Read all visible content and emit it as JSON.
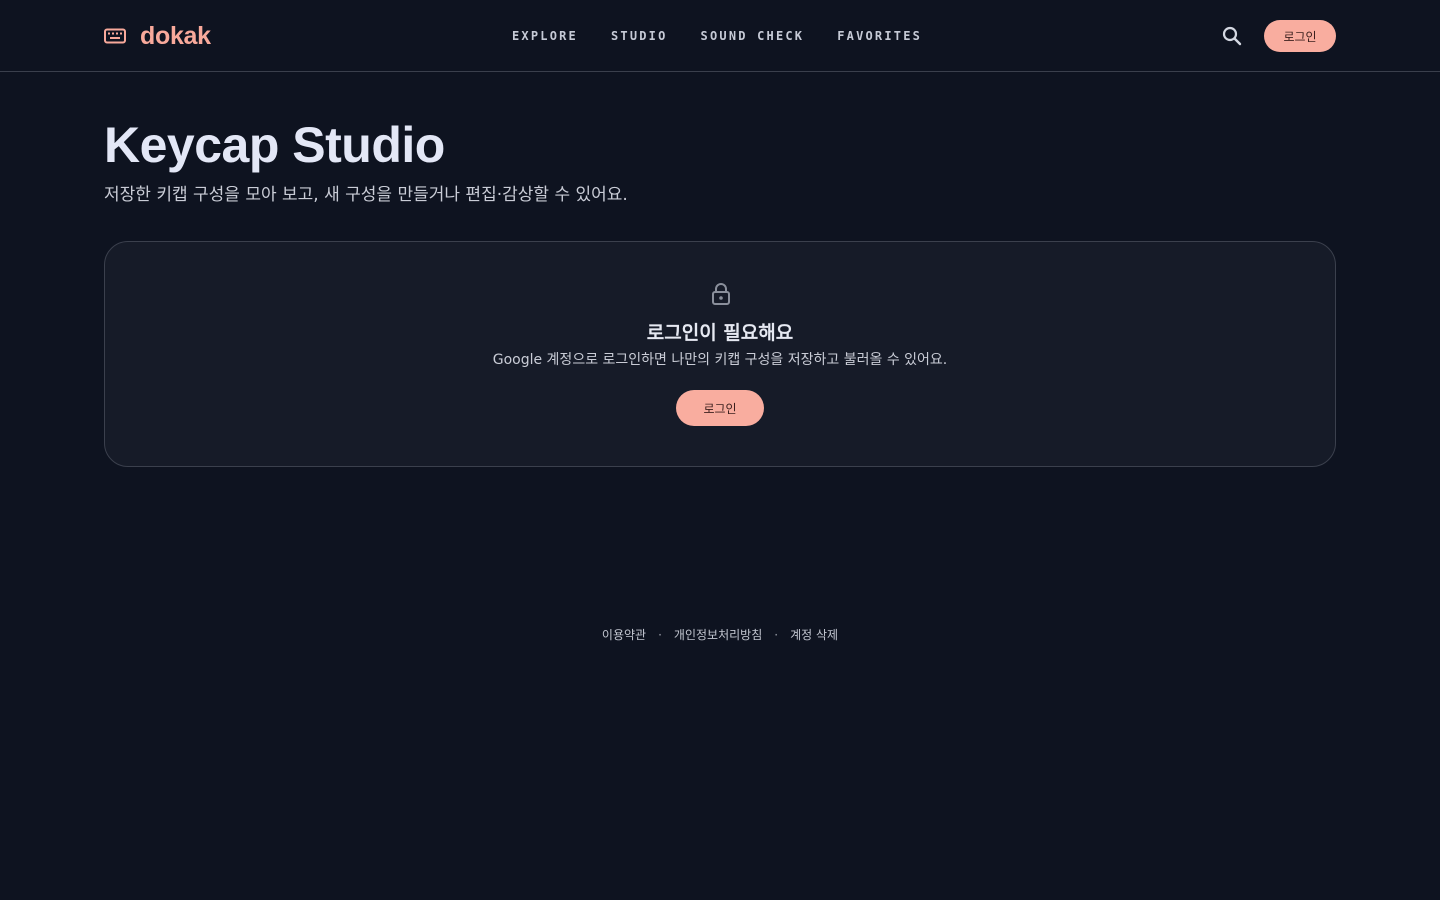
{
  "header": {
    "logo_text": "dokak",
    "logo_icon": "keyboard-icon",
    "nav": [
      {
        "label": "EXPLORE"
      },
      {
        "label": "STUDIO"
      },
      {
        "label": "SOUND CHECK"
      },
      {
        "label": "FAVORITES"
      }
    ],
    "search_icon": "search-icon",
    "login_label": "로그인"
  },
  "main": {
    "title": "Keycap Studio",
    "subtitle": "저장한 키캡 구성을 모아 보고, 새 구성을 만들거나 편집·감상할 수 있어요.",
    "card": {
      "icon": "lock-icon",
      "title": "로그인이 필요해요",
      "description": "Google 계정으로 로그인하면 나만의 키캡 구성을 저장하고 불러올 수 있어요.",
      "button_label": "로그인"
    }
  },
  "footer": {
    "links": [
      {
        "label": "이용약관"
      },
      {
        "label": "개인정보처리방침"
      },
      {
        "label": "계정 삭제"
      }
    ],
    "separator": "·"
  },
  "colors": {
    "background": "#0e1320",
    "card_background": "#161b28",
    "accent": "#f9ad9f",
    "border": "#3b404d"
  }
}
